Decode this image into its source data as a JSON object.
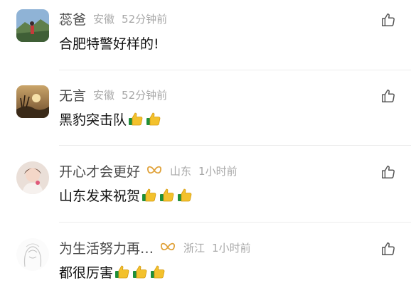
{
  "comments": [
    {
      "author": "蕊爸",
      "location": "安徽",
      "time": "52分钟前",
      "text": "合肥特警好样的!",
      "emoji_count": 0,
      "badge": false
    },
    {
      "author": "无言",
      "location": "安徽",
      "time": "52分钟前",
      "text": "黑豹突击队",
      "emoji_count": 2,
      "badge": false
    },
    {
      "author": "开心才会更好",
      "location": "山东",
      "time": "1小时前",
      "text": "山东发来祝贺",
      "emoji_count": 3,
      "badge": true
    },
    {
      "author": "为生活努力再…",
      "location": "浙江",
      "time": "1小时前",
      "text": "都很厉害",
      "emoji_count": 3,
      "badge": true
    }
  ],
  "icons": {
    "like": "thumbs-up-outline-icon",
    "emoji": "thumbs-up-emoji",
    "badge": "gold-ribbon-badge-icon"
  },
  "colors": {
    "name": "#4a4a4a",
    "meta": "#a8a8a8",
    "text": "#111111",
    "badge": "#e0a23a",
    "emoji": "#f3c12c",
    "emoji_cuff": "#1f8f3a"
  }
}
